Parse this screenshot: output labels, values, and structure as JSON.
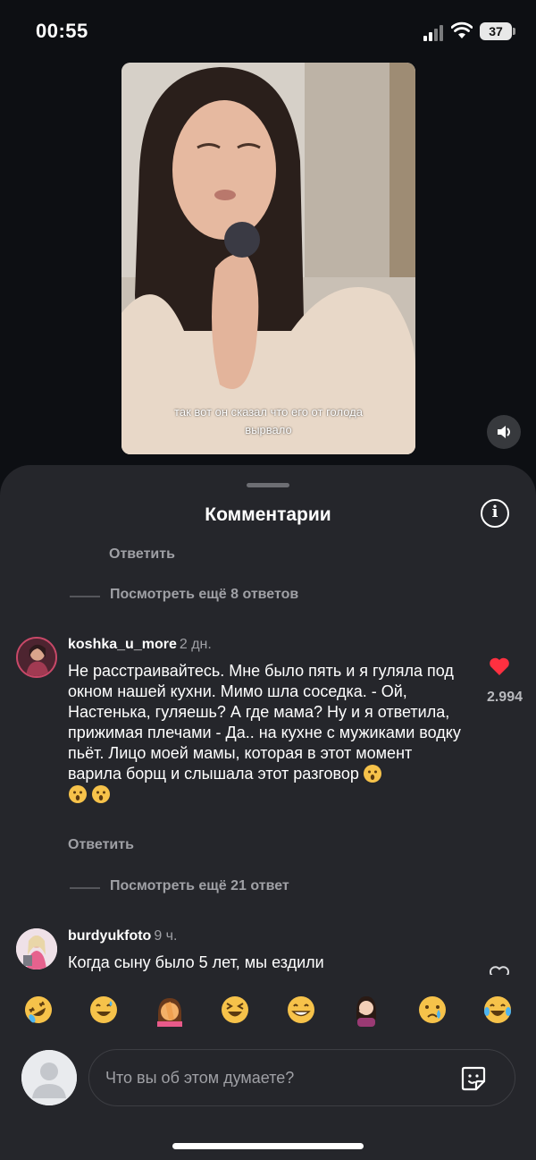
{
  "status": {
    "time": "00:55",
    "battery": "37"
  },
  "video": {
    "subtitle": "так вот он сказал что его от голода вырвало"
  },
  "sheet": {
    "title": "Комментарии"
  },
  "thread_top": {
    "reply_label": "Ответить",
    "more_replies": "Посмотреть ещё 8 ответов"
  },
  "comments": [
    {
      "username": "koshka_u_more",
      "time": "2 дн.",
      "text": "Не расстраивайтесь.  Мне было пять и я гуляла под окном нашей кухни. Мимо шла соседка. - Ой, Настенька,  гуляешь? А где мама? Ну и я ответила, прижимая плечами - Да.. на кухне с мужиками водку пьёт. Лицо моей мамы, которая в этот момент варила борщ и слышала этот разговор",
      "likes": "2.994",
      "liked": true,
      "reply_label": "Ответить",
      "more_replies": "Посмотреть ещё 21 ответ"
    },
    {
      "username": "burdyukfoto",
      "time": "9 ч.",
      "text": "Когда сыну было 5 лет, мы ездили",
      "liked": false
    }
  ],
  "quick_emojis": [
    "rolling-laughing",
    "sweat-smile",
    "facepalm",
    "squinting-laugh",
    "grin",
    "face-with-hand",
    "crying",
    "tears-of-joy"
  ],
  "composer": {
    "placeholder": "Что вы об этом думаете?"
  },
  "colors": {
    "sheet_bg": "#25262b",
    "like_red": "#ff3040",
    "muted_text": "#9fa0a5"
  }
}
